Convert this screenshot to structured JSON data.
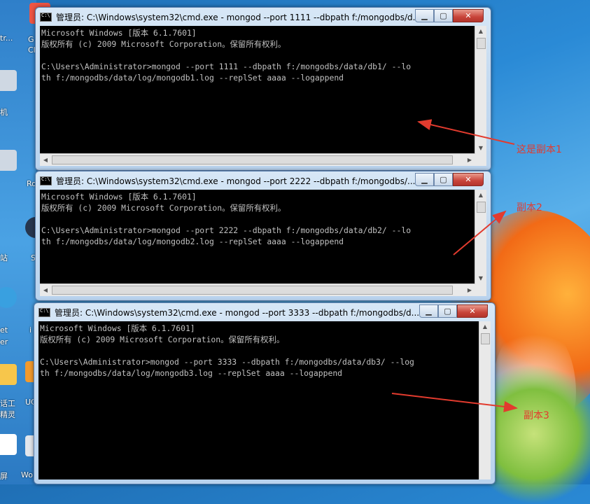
{
  "desktop": {
    "fragments": [
      "tr...",
      "G",
      "Cl",
      "机",
      "Ro",
      "站",
      "S",
      "et",
      "er",
      "i",
      "UC",
      "话工",
      "精灵",
      "屏",
      "Wo"
    ]
  },
  "windows": [
    {
      "title": "管理员: C:\\Windows\\system32\\cmd.exe - mongod  --port 1111 --dbpath f:/mongodbs/d...",
      "lines": [
        "Microsoft Windows [版本 6.1.7601]",
        "版权所有 (c) 2009 Microsoft Corporation。保留所有权利。",
        "",
        "C:\\Users\\Administrator>mongod --port 1111 --dbpath f:/mongodbs/data/db1/ --lo",
        "th f:/mongodbs/data/log/mongodb1.log --replSet aaaa --logappend"
      ]
    },
    {
      "title": "管理员: C:\\Windows\\system32\\cmd.exe - mongod  --port 2222 --dbpath f:/mongodbs/...",
      "lines": [
        "Microsoft Windows [版本 6.1.7601]",
        "版权所有 (c) 2009 Microsoft Corporation。保留所有权利。",
        "",
        "C:\\Users\\Administrator>mongod --port 2222 --dbpath f:/mongodbs/data/db2/ --lo",
        "th f:/mongodbs/data/log/mongodb2.log --replSet aaaa --logappend"
      ]
    },
    {
      "title": "管理员: C:\\Windows\\system32\\cmd.exe - mongod  --port 3333 --dbpath f:/mongodbs/d...",
      "lines": [
        "Microsoft Windows [版本 6.1.7601]",
        "版权所有 (c) 2009 Microsoft Corporation。保留所有权利。",
        "",
        "C:\\Users\\Administrator>mongod --port 3333 --dbpath f:/mongodbs/data/db3/ --log",
        "th f:/mongodbs/data/log/mongodb3.log --replSet aaaa --logappend"
      ]
    }
  ],
  "annotations": {
    "replica1": "这是副本1",
    "replica2": "副本2",
    "replica3": "副本3"
  },
  "colors": {
    "annotation": "#e23b2e",
    "console_bg": "#000000",
    "console_text": "#c0c0c0"
  },
  "icons": {
    "window": "cmd-icon",
    "minimize": "minimize-icon",
    "maximize": "maximize-icon",
    "close": "close-icon"
  }
}
